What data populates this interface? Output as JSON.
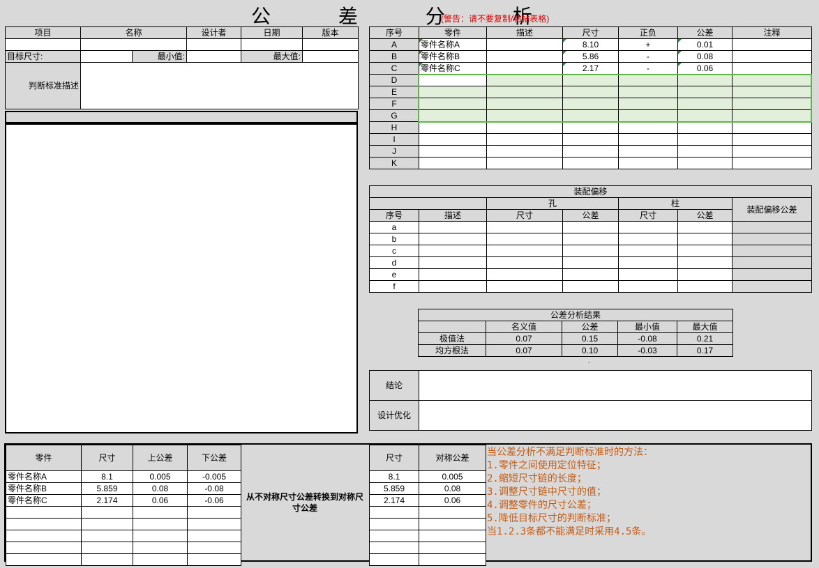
{
  "title": "公 差 分 析",
  "warning": "(警告：请不要复制/粘帖表格)",
  "info": {
    "headers": [
      "项目",
      "名称",
      "设计者",
      "日期",
      "版本"
    ],
    "target_label": "目标尺寸:",
    "min_label": "最小值:",
    "max_label": "最大值:",
    "criteria_label": "判断标准描述"
  },
  "parts": {
    "headers": [
      "序号",
      "零件",
      "描述",
      "尺寸",
      "正负",
      "公差",
      "注释"
    ],
    "rows": [
      {
        "id": "A",
        "part": "零件名称A",
        "desc": "",
        "size": "8.10",
        "sign": "+",
        "tol": "0.01",
        "note": ""
      },
      {
        "id": "B",
        "part": "零件名称B",
        "desc": "",
        "size": "5.86",
        "sign": "-",
        "tol": "0.08",
        "note": ""
      },
      {
        "id": "C",
        "part": "零件名称C",
        "desc": "",
        "size": "2.17",
        "sign": "-",
        "tol": "0.06",
        "note": ""
      },
      {
        "id": "D",
        "part": "",
        "desc": "",
        "size": "",
        "sign": "",
        "tol": "",
        "note": ""
      },
      {
        "id": "E",
        "part": "",
        "desc": "",
        "size": "",
        "sign": "",
        "tol": "",
        "note": ""
      },
      {
        "id": "F",
        "part": "",
        "desc": "",
        "size": "",
        "sign": "",
        "tol": "",
        "note": ""
      },
      {
        "id": "G",
        "part": "",
        "desc": "",
        "size": "",
        "sign": "",
        "tol": "",
        "note": ""
      },
      {
        "id": "H",
        "part": "",
        "desc": "",
        "size": "",
        "sign": "",
        "tol": "",
        "note": ""
      },
      {
        "id": "I",
        "part": "",
        "desc": "",
        "size": "",
        "sign": "",
        "tol": "",
        "note": ""
      },
      {
        "id": "J",
        "part": "",
        "desc": "",
        "size": "",
        "sign": "",
        "tol": "",
        "note": ""
      },
      {
        "id": "K",
        "part": "",
        "desc": "",
        "size": "",
        "sign": "",
        "tol": "",
        "note": ""
      }
    ]
  },
  "assembly": {
    "title": "装配偏移",
    "hole": "孔",
    "pin": "柱",
    "offset_tol": "装配偏移公差",
    "headers": [
      "序号",
      "描述",
      "尺寸",
      "公差",
      "尺寸",
      "公差"
    ],
    "rows": [
      "a",
      "b",
      "c",
      "d",
      "e",
      "f"
    ]
  },
  "results": {
    "title": "公差分析结果",
    "headers": [
      "名义值",
      "公差",
      "最小值",
      "最大值"
    ],
    "rows": [
      {
        "method": "极值法",
        "nominal": "0.07",
        "tol": "0.15",
        "min": "-0.08",
        "max": "0.21"
      },
      {
        "method": "均方根法",
        "nominal": "0.07",
        "tol": "0.10",
        "min": "-0.03",
        "max": "0.17"
      }
    ],
    "dot": "."
  },
  "conclusion": {
    "label": "结论",
    "optimize": "设计优化"
  },
  "convert": {
    "headers": [
      "零件",
      "尺寸",
      "上公差",
      "下公差"
    ],
    "rows": [
      {
        "part": "零件名称A",
        "size": "8.1",
        "upper": "0.005",
        "lower": "-0.005"
      },
      {
        "part": "零件名称B",
        "size": "5.859",
        "upper": "0.08",
        "lower": "-0.08"
      },
      {
        "part": "零件名称C",
        "size": "2.174",
        "upper": "0.06",
        "lower": "-0.06"
      }
    ],
    "middle": "从不对称尺寸公差转换到对称尺寸公差",
    "right_headers": [
      "尺寸",
      "对称公差"
    ],
    "right_rows": [
      {
        "size": "8.1",
        "tol": "0.005"
      },
      {
        "size": "5.859",
        "tol": "0.08"
      },
      {
        "size": "2.174",
        "tol": "0.06"
      }
    ]
  },
  "methods": [
    "当公差分析不满足判断标准时的方法：",
    "1.零件之间使用定位特征；",
    "2.缩短尺寸链的长度；",
    "3.调整尺寸链中尺寸的值；",
    "4.调整零件的尺寸公差；",
    "5.降低目标尺寸的判断标准；",
    "当1.2.3条都不能满足时采用4.5条。"
  ]
}
